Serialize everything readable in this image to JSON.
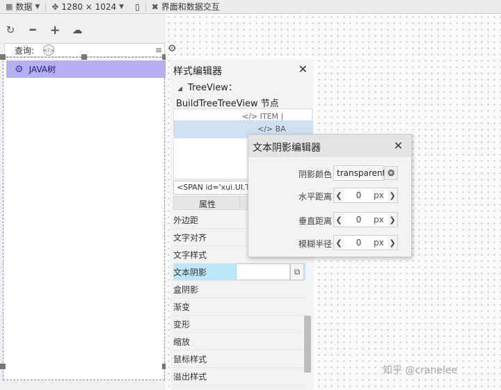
{
  "toolbar": {
    "data_label": "数据",
    "resolution": "1280 × 1024",
    "interaction_label": "界面和数据交互"
  },
  "left_panel": {
    "search_label": "查询:",
    "search_value": "",
    "search_code_icon": "</>",
    "tree": [
      {
        "label": "JAVA树",
        "selected": true,
        "icon": "gears-icon"
      }
    ]
  },
  "style_editor": {
    "title": "样式编辑器",
    "node_line1": "TreeView：",
    "node_line2": "BuildTreeTreeView 节点",
    "tree_item1": "</> ITEM |",
    "tree_item2": "</> BA",
    "span_text": "<SPAN id='xui.UI.T",
    "prop_header": "属性",
    "properties": [
      "外边距",
      "文字对齐",
      "文字样式",
      "文本阴影",
      "盒阴影",
      "渐变",
      "变形",
      "缩放",
      "鼠标样式",
      "溢出样式"
    ],
    "active_index": 3
  },
  "shadow_dialog": {
    "title": "文本阴影编辑器",
    "color_label": "阴影颜色",
    "color_value": "transparent",
    "h_label": "水平距离",
    "h_value": "0",
    "v_label": "垂直距离",
    "v_value": "0",
    "blur_label": "模糊半径",
    "blur_value": "0",
    "unit": "px"
  },
  "watermark": "知乎 @cranelee"
}
